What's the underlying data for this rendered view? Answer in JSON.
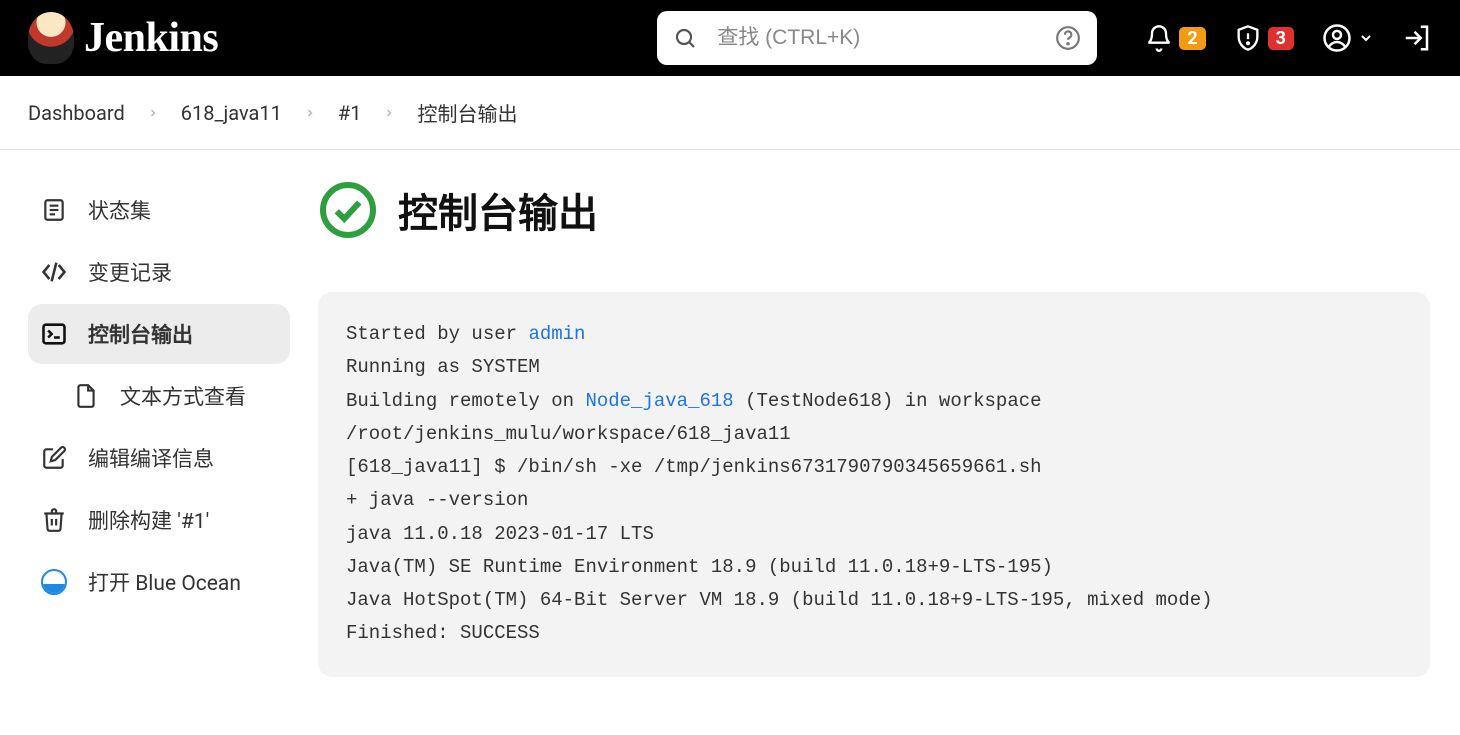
{
  "header": {
    "app_name": "Jenkins",
    "search_placeholder": "查找 (CTRL+K)",
    "notif_badge": "2",
    "alert_badge": "3"
  },
  "breadcrumbs": {
    "items": [
      "Dashboard",
      "618_java11",
      "#1",
      "控制台输出"
    ]
  },
  "sidebar": {
    "status": "状态集",
    "changes": "变更记录",
    "console": "控制台输出",
    "console_text": "文本方式查看",
    "edit_build": "编辑编译信息",
    "delete_build": "删除构建 '#1'",
    "blue_ocean": "打开 Blue Ocean"
  },
  "page": {
    "title": "控制台输出"
  },
  "console": {
    "line1_prefix": "Started by user ",
    "line1_link": "admin",
    "line2": "Running as SYSTEM",
    "line3_prefix": "Building remotely on ",
    "line3_link": "Node_java_618",
    "line3_suffix": " (TestNode618) in workspace /root/jenkins_mulu/workspace/618_java11",
    "line4": "[618_java11] $ /bin/sh -xe /tmp/jenkins6731790790345659661.sh",
    "line5": "+ java --version",
    "line6": "java 11.0.18 2023-01-17 LTS",
    "line7": "Java(TM) SE Runtime Environment 18.9 (build 11.0.18+9-LTS-195)",
    "line8": "Java HotSpot(TM) 64-Bit Server VM 18.9 (build 11.0.18+9-LTS-195, mixed mode)",
    "line9": "Finished: SUCCESS"
  }
}
